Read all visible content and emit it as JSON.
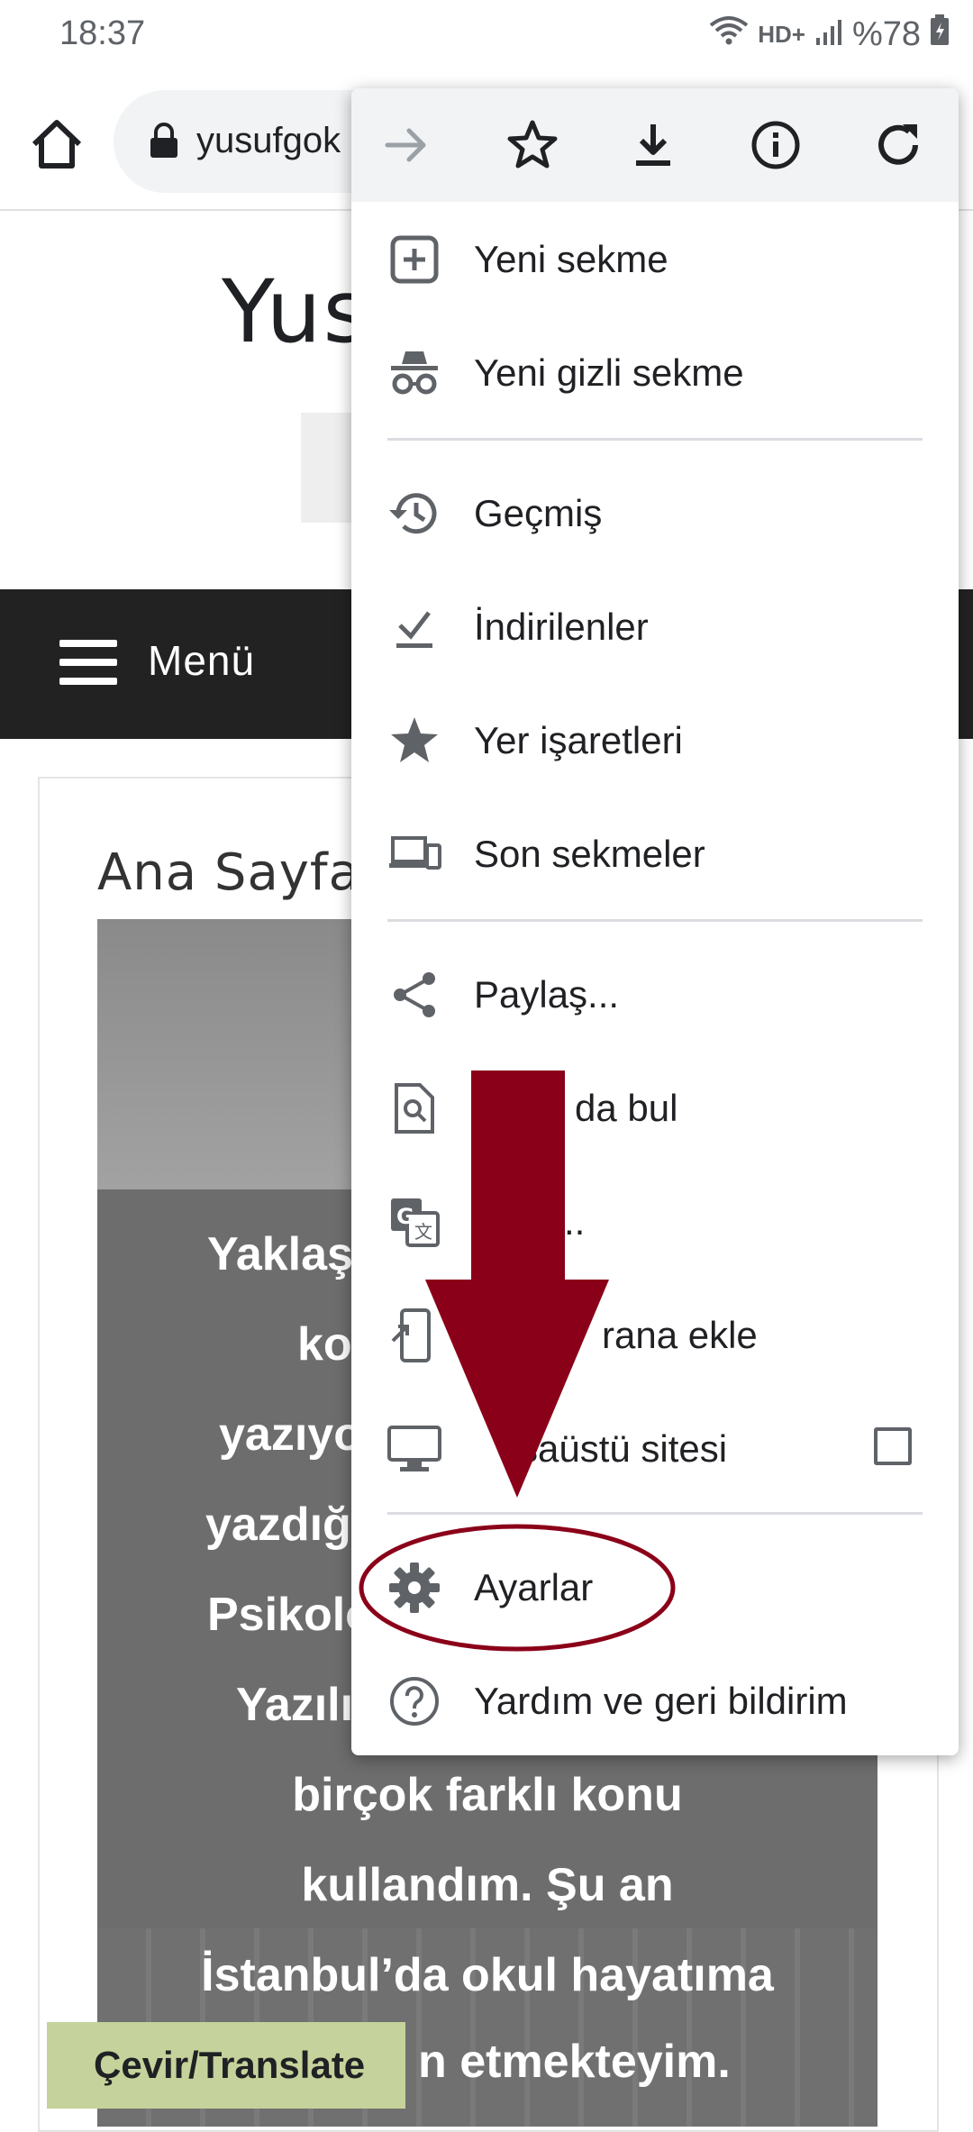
{
  "status_bar": {
    "time": "18:37",
    "network": "HD+",
    "battery": "%78"
  },
  "toolbar": {
    "url": "yusufgok"
  },
  "page": {
    "site_title": "Yus",
    "nav_menu_label": "Menü",
    "breadcrumb": "Ana Sayfa",
    "hero_lines": [
      "Yaklaş",
      "ko",
      "yazıyo",
      "yazdığ",
      "Psikolo",
      "Yazılı",
      "birçok farklı konu",
      "kullandım. Şu an",
      "İstanbul’da okul hayatıma",
      "n etmekteyim."
    ],
    "translate_button": "Çevir/Translate"
  },
  "menu": {
    "toolbar_icons": [
      "forward-icon",
      "bookmark-star-icon",
      "download-icon",
      "info-icon",
      "refresh-icon"
    ],
    "items": [
      {
        "label": "Yeni sekme",
        "icon": "new-tab-icon"
      },
      {
        "label": "Yeni gizli sekme",
        "icon": "incognito-icon"
      },
      {
        "label": "Geçmiş",
        "icon": "history-icon"
      },
      {
        "label": "İndirilenler",
        "icon": "downloads-icon"
      },
      {
        "label": "Yer işaretleri",
        "icon": "bookmarks-star-icon"
      },
      {
        "label": "Son sekmeler",
        "icon": "recent-tabs-icon"
      },
      {
        "label": "Paylaş...",
        "icon": "share-icon"
      },
      {
        "label": "da bul",
        "icon": "find-in-page-icon"
      },
      {
        "label": "..",
        "icon": "translate-icon"
      },
      {
        "label": "rana ekle",
        "icon": "add-to-home-icon"
      },
      {
        "label": "saüstü sitesi",
        "icon": "desktop-icon"
      },
      {
        "label": "Ayarlar",
        "icon": "gear-icon"
      },
      {
        "label": "Yardım ve geri bildirim",
        "icon": "help-icon"
      }
    ]
  },
  "colors": {
    "arrow": "#8b0019",
    "highlight_ellipse": "#8b0019",
    "navbar": "#222222",
    "translate_button": "#c5d29b"
  }
}
